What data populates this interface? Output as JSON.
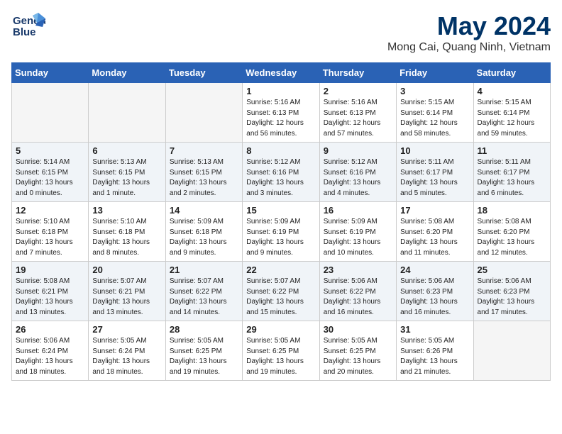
{
  "logo": {
    "line1": "General",
    "line2": "Blue"
  },
  "title": "May 2024",
  "subtitle": "Mong Cai, Quang Ninh, Vietnam",
  "headers": [
    "Sunday",
    "Monday",
    "Tuesday",
    "Wednesday",
    "Thursday",
    "Friday",
    "Saturday"
  ],
  "weeks": [
    [
      {
        "day": "",
        "info": ""
      },
      {
        "day": "",
        "info": ""
      },
      {
        "day": "",
        "info": ""
      },
      {
        "day": "1",
        "info": "Sunrise: 5:16 AM\nSunset: 6:13 PM\nDaylight: 12 hours\nand 56 minutes."
      },
      {
        "day": "2",
        "info": "Sunrise: 5:16 AM\nSunset: 6:13 PM\nDaylight: 12 hours\nand 57 minutes."
      },
      {
        "day": "3",
        "info": "Sunrise: 5:15 AM\nSunset: 6:14 PM\nDaylight: 12 hours\nand 58 minutes."
      },
      {
        "day": "4",
        "info": "Sunrise: 5:15 AM\nSunset: 6:14 PM\nDaylight: 12 hours\nand 59 minutes."
      }
    ],
    [
      {
        "day": "5",
        "info": "Sunrise: 5:14 AM\nSunset: 6:15 PM\nDaylight: 13 hours\nand 0 minutes."
      },
      {
        "day": "6",
        "info": "Sunrise: 5:13 AM\nSunset: 6:15 PM\nDaylight: 13 hours\nand 1 minute."
      },
      {
        "day": "7",
        "info": "Sunrise: 5:13 AM\nSunset: 6:15 PM\nDaylight: 13 hours\nand 2 minutes."
      },
      {
        "day": "8",
        "info": "Sunrise: 5:12 AM\nSunset: 6:16 PM\nDaylight: 13 hours\nand 3 minutes."
      },
      {
        "day": "9",
        "info": "Sunrise: 5:12 AM\nSunset: 6:16 PM\nDaylight: 13 hours\nand 4 minutes."
      },
      {
        "day": "10",
        "info": "Sunrise: 5:11 AM\nSunset: 6:17 PM\nDaylight: 13 hours\nand 5 minutes."
      },
      {
        "day": "11",
        "info": "Sunrise: 5:11 AM\nSunset: 6:17 PM\nDaylight: 13 hours\nand 6 minutes."
      }
    ],
    [
      {
        "day": "12",
        "info": "Sunrise: 5:10 AM\nSunset: 6:18 PM\nDaylight: 13 hours\nand 7 minutes."
      },
      {
        "day": "13",
        "info": "Sunrise: 5:10 AM\nSunset: 6:18 PM\nDaylight: 13 hours\nand 8 minutes."
      },
      {
        "day": "14",
        "info": "Sunrise: 5:09 AM\nSunset: 6:18 PM\nDaylight: 13 hours\nand 9 minutes."
      },
      {
        "day": "15",
        "info": "Sunrise: 5:09 AM\nSunset: 6:19 PM\nDaylight: 13 hours\nand 9 minutes."
      },
      {
        "day": "16",
        "info": "Sunrise: 5:09 AM\nSunset: 6:19 PM\nDaylight: 13 hours\nand 10 minutes."
      },
      {
        "day": "17",
        "info": "Sunrise: 5:08 AM\nSunset: 6:20 PM\nDaylight: 13 hours\nand 11 minutes."
      },
      {
        "day": "18",
        "info": "Sunrise: 5:08 AM\nSunset: 6:20 PM\nDaylight: 13 hours\nand 12 minutes."
      }
    ],
    [
      {
        "day": "19",
        "info": "Sunrise: 5:08 AM\nSunset: 6:21 PM\nDaylight: 13 hours\nand 13 minutes."
      },
      {
        "day": "20",
        "info": "Sunrise: 5:07 AM\nSunset: 6:21 PM\nDaylight: 13 hours\nand 13 minutes."
      },
      {
        "day": "21",
        "info": "Sunrise: 5:07 AM\nSunset: 6:22 PM\nDaylight: 13 hours\nand 14 minutes."
      },
      {
        "day": "22",
        "info": "Sunrise: 5:07 AM\nSunset: 6:22 PM\nDaylight: 13 hours\nand 15 minutes."
      },
      {
        "day": "23",
        "info": "Sunrise: 5:06 AM\nSunset: 6:22 PM\nDaylight: 13 hours\nand 16 minutes."
      },
      {
        "day": "24",
        "info": "Sunrise: 5:06 AM\nSunset: 6:23 PM\nDaylight: 13 hours\nand 16 minutes."
      },
      {
        "day": "25",
        "info": "Sunrise: 5:06 AM\nSunset: 6:23 PM\nDaylight: 13 hours\nand 17 minutes."
      }
    ],
    [
      {
        "day": "26",
        "info": "Sunrise: 5:06 AM\nSunset: 6:24 PM\nDaylight: 13 hours\nand 18 minutes."
      },
      {
        "day": "27",
        "info": "Sunrise: 5:05 AM\nSunset: 6:24 PM\nDaylight: 13 hours\nand 18 minutes."
      },
      {
        "day": "28",
        "info": "Sunrise: 5:05 AM\nSunset: 6:25 PM\nDaylight: 13 hours\nand 19 minutes."
      },
      {
        "day": "29",
        "info": "Sunrise: 5:05 AM\nSunset: 6:25 PM\nDaylight: 13 hours\nand 19 minutes."
      },
      {
        "day": "30",
        "info": "Sunrise: 5:05 AM\nSunset: 6:25 PM\nDaylight: 13 hours\nand 20 minutes."
      },
      {
        "day": "31",
        "info": "Sunrise: 5:05 AM\nSunset: 6:26 PM\nDaylight: 13 hours\nand 21 minutes."
      },
      {
        "day": "",
        "info": ""
      }
    ]
  ]
}
